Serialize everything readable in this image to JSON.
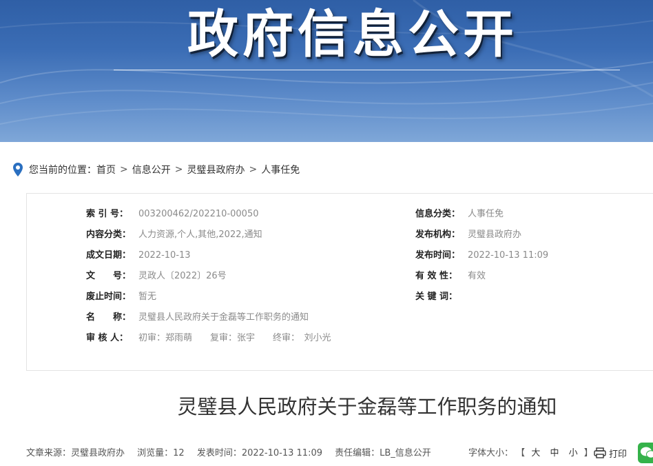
{
  "banner": {
    "title": "政府信息公开"
  },
  "breadcrumb": {
    "prefix": "您当前的位置：",
    "items": [
      "首页",
      "信息公开",
      "灵璧县政府办",
      "人事任免"
    ],
    "separator": ">"
  },
  "info": {
    "left": [
      {
        "label": "索 引 号：",
        "value": "003200462/202210-00050"
      },
      {
        "label": "内容分类：",
        "value": "人力资源,个人,其他,2022,通知"
      },
      {
        "label": "成文日期：",
        "value": "2022-10-13"
      },
      {
        "label": "文　　号：",
        "value": "灵政人〔2022〕26号"
      },
      {
        "label": "废止时间：",
        "value": "暂无"
      },
      {
        "label": "名　　称：",
        "value": "灵璧县人民政府关于金磊等工作职务的通知"
      },
      {
        "label": "审 核 人：",
        "value": "初审：郑雨萌　　复审：张宇　　终审：　刘小光"
      }
    ],
    "right": [
      {
        "label": "信息分类：",
        "value": "人事任免"
      },
      {
        "label": "发布机构：",
        "value": "灵璧县政府办"
      },
      {
        "label": "发布时间：",
        "value": "2022-10-13 11:09"
      },
      {
        "label": "有 效 性：",
        "value": "有效"
      },
      {
        "label": "关 键 词：",
        "value": ""
      }
    ]
  },
  "article": {
    "title": "灵璧县人民政府关于金磊等工作职务的通知"
  },
  "meta": {
    "source": "文章来源：灵璧县政府办",
    "views": "浏览量：12",
    "published": "发表时间：2022-10-13 11:09",
    "editor": "责任编辑：LB_信息公开",
    "fontsize_label": "字体大小：",
    "fontsize_open": "【",
    "fontsize_large": "大",
    "fontsize_medium": "中",
    "fontsize_small": "小",
    "fontsize_close": "】",
    "print": "打印"
  },
  "colors": {
    "banner": "#3b6db5",
    "wechat": "#35b24a",
    "pin": "#2a6fc0"
  }
}
